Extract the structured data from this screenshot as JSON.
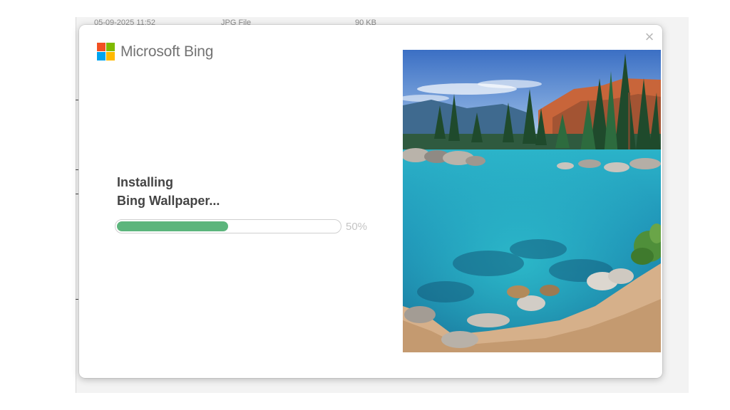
{
  "background": {
    "file_date": "05-09-2025 11:52",
    "file_type": "JPG File",
    "file_size": "90 KB"
  },
  "dialog": {
    "close_glyph": "×",
    "brand": {
      "name": "Microsoft Bing",
      "logo_colors": [
        "#f25022",
        "#7fba00",
        "#00a4ef",
        "#ffb900"
      ]
    },
    "status_line1": "Installing",
    "status_line2": "Bing Wallpaper...",
    "progress": {
      "value": 50,
      "label": "50%",
      "color": "#5cb57c"
    },
    "image": {
      "icon": "landscape-photo"
    }
  }
}
